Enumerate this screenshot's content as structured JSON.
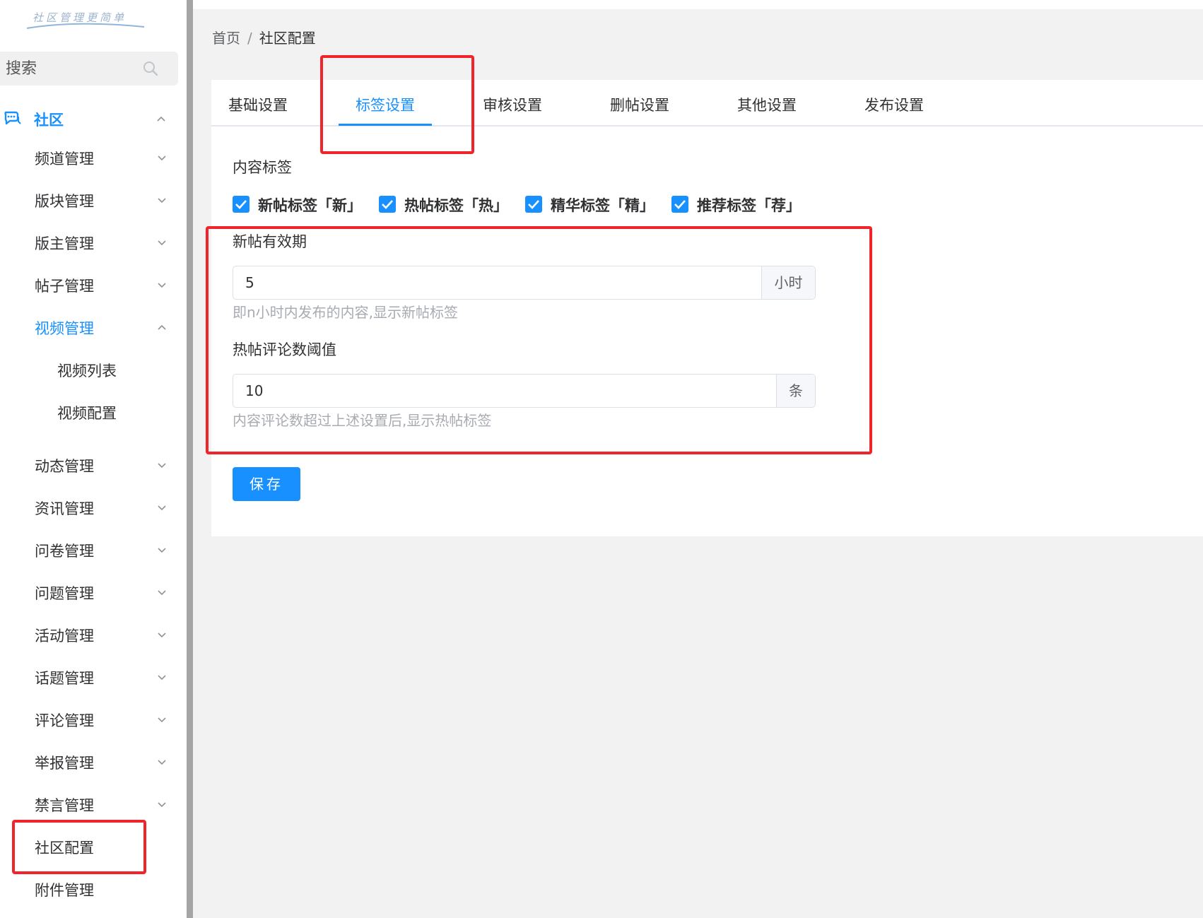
{
  "logo": {
    "text": "社区管理更简单"
  },
  "search": {
    "placeholder": "搜索"
  },
  "sidebar": {
    "root": {
      "label": "社区",
      "icon": "chat-bubbles-icon",
      "expanded": true
    },
    "items": [
      {
        "label": "频道管理",
        "expanded": false
      },
      {
        "label": "版块管理",
        "expanded": false
      },
      {
        "label": "版主管理",
        "expanded": false
      },
      {
        "label": "帖子管理",
        "expanded": false
      },
      {
        "label": "视频管理",
        "expanded": true,
        "active": true
      },
      {
        "label": "视频列表",
        "sub": true
      },
      {
        "label": "视频配置",
        "sub": true
      },
      {
        "label": "动态管理",
        "expanded": false
      },
      {
        "label": "资讯管理",
        "expanded": false
      },
      {
        "label": "问卷管理",
        "expanded": false
      },
      {
        "label": "问题管理",
        "expanded": false
      },
      {
        "label": "活动管理",
        "expanded": false
      },
      {
        "label": "话题管理",
        "expanded": false
      },
      {
        "label": "评论管理",
        "expanded": false
      },
      {
        "label": "举报管理",
        "expanded": false
      },
      {
        "label": "禁言管理",
        "expanded": false
      },
      {
        "label": "社区配置",
        "current": true
      },
      {
        "label": "附件管理"
      }
    ]
  },
  "breadcrumb": {
    "home": "首页",
    "separator": "/",
    "current": "社区配置"
  },
  "tabs": [
    {
      "label": "基础设置"
    },
    {
      "label": "标签设置",
      "active": true
    },
    {
      "label": "审核设置"
    },
    {
      "label": "删帖设置"
    },
    {
      "label": "其他设置"
    },
    {
      "label": "发布设置"
    }
  ],
  "form": {
    "content_tags_label": "内容标签",
    "checkboxes": [
      {
        "label": "新帖标签「新」",
        "checked": true
      },
      {
        "label": "热帖标签「热」",
        "checked": true
      },
      {
        "label": "精华标签「精」",
        "checked": true
      },
      {
        "label": "推荐标签「荐」",
        "checked": true
      }
    ],
    "new_post": {
      "label": "新帖有效期",
      "value": "5",
      "unit": "小时",
      "hint": "即n小时内发布的内容,显示新帖标签"
    },
    "hot_post": {
      "label": "热帖评论数阈值",
      "value": "10",
      "unit": "条",
      "hint": "内容评论数超过上述设置后,显示热帖标签"
    },
    "save_label": "保存"
  },
  "colors": {
    "accent": "#1890ff",
    "highlight": "#f0252b",
    "hint_text": "#a8abb2"
  }
}
